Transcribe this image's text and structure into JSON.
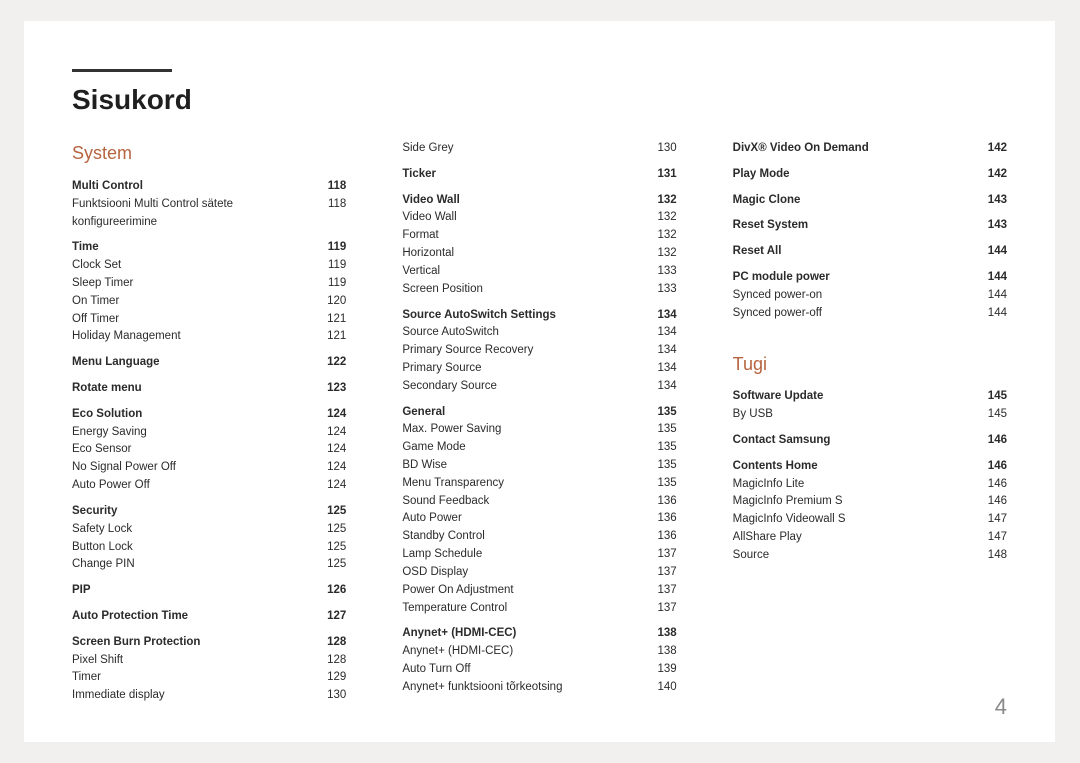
{
  "title": "Sisukord",
  "page_number": "4",
  "columns": [
    {
      "blocks": [
        {
          "type": "section",
          "label": "System"
        },
        {
          "type": "row",
          "bold": true,
          "label": "Multi Control",
          "page": "118"
        },
        {
          "type": "row",
          "label": "Funktsiooni Multi Control sätete konfigureerimine",
          "page": "118"
        },
        {
          "type": "gap"
        },
        {
          "type": "row",
          "bold": true,
          "label": "Time",
          "page": "119"
        },
        {
          "type": "row",
          "label": "Clock Set",
          "page": "119"
        },
        {
          "type": "row",
          "label": "Sleep Timer",
          "page": "119"
        },
        {
          "type": "row",
          "label": "On Timer",
          "page": "120"
        },
        {
          "type": "row",
          "label": "Off Timer",
          "page": "121"
        },
        {
          "type": "row",
          "label": "Holiday Management",
          "page": "121"
        },
        {
          "type": "gap"
        },
        {
          "type": "row",
          "bold": true,
          "label": "Menu Language",
          "page": "122"
        },
        {
          "type": "gap"
        },
        {
          "type": "row",
          "bold": true,
          "label": "Rotate menu",
          "page": "123"
        },
        {
          "type": "gap"
        },
        {
          "type": "row",
          "bold": true,
          "label": "Eco Solution",
          "page": "124"
        },
        {
          "type": "row",
          "label": "Energy Saving",
          "page": "124"
        },
        {
          "type": "row",
          "label": "Eco Sensor",
          "page": "124"
        },
        {
          "type": "row",
          "label": "No Signal Power Off",
          "page": "124"
        },
        {
          "type": "row",
          "label": "Auto Power Off",
          "page": "124"
        },
        {
          "type": "gap"
        },
        {
          "type": "row",
          "bold": true,
          "label": "Security",
          "page": "125"
        },
        {
          "type": "row",
          "label": "Safety Lock",
          "page": "125"
        },
        {
          "type": "row",
          "label": "Button Lock",
          "page": "125"
        },
        {
          "type": "row",
          "label": "Change PIN",
          "page": "125"
        },
        {
          "type": "gap"
        },
        {
          "type": "row",
          "bold": true,
          "label": "PIP",
          "page": "126"
        },
        {
          "type": "gap"
        },
        {
          "type": "row",
          "bold": true,
          "label": "Auto Protection Time",
          "page": "127"
        },
        {
          "type": "gap"
        },
        {
          "type": "row",
          "bold": true,
          "label": "Screen Burn Protection",
          "page": "128"
        },
        {
          "type": "row",
          "label": "Pixel Shift",
          "page": "128"
        },
        {
          "type": "row",
          "label": "Timer",
          "page": "129"
        },
        {
          "type": "row",
          "label": "Immediate display",
          "page": "130"
        }
      ]
    },
    {
      "blocks": [
        {
          "type": "row",
          "label": "Side Grey",
          "page": "130"
        },
        {
          "type": "gap"
        },
        {
          "type": "row",
          "bold": true,
          "label": "Ticker",
          "page": "131"
        },
        {
          "type": "gap"
        },
        {
          "type": "row",
          "bold": true,
          "label": "Video Wall",
          "page": "132"
        },
        {
          "type": "row",
          "label": "Video Wall",
          "page": "132"
        },
        {
          "type": "row",
          "label": "Format",
          "page": "132"
        },
        {
          "type": "row",
          "label": "Horizontal",
          "page": "132"
        },
        {
          "type": "row",
          "label": "Vertical",
          "page": "133"
        },
        {
          "type": "row",
          "label": "Screen Position",
          "page": "133"
        },
        {
          "type": "gap"
        },
        {
          "type": "row",
          "bold": true,
          "label": "Source AutoSwitch Settings",
          "page": "134"
        },
        {
          "type": "row",
          "label": "Source AutoSwitch",
          "page": "134"
        },
        {
          "type": "row",
          "label": "Primary Source Recovery",
          "page": "134"
        },
        {
          "type": "row",
          "label": "Primary Source",
          "page": "134"
        },
        {
          "type": "row",
          "label": "Secondary Source",
          "page": "134"
        },
        {
          "type": "gap"
        },
        {
          "type": "row",
          "bold": true,
          "label": "General",
          "page": "135"
        },
        {
          "type": "row",
          "label": "Max. Power Saving",
          "page": "135"
        },
        {
          "type": "row",
          "label": "Game Mode",
          "page": "135"
        },
        {
          "type": "row",
          "label": "BD Wise",
          "page": "135"
        },
        {
          "type": "row",
          "label": "Menu Transparency",
          "page": "135"
        },
        {
          "type": "row",
          "label": "Sound Feedback",
          "page": "136"
        },
        {
          "type": "row",
          "label": "Auto Power",
          "page": "136"
        },
        {
          "type": "row",
          "label": "Standby Control",
          "page": "136"
        },
        {
          "type": "row",
          "label": "Lamp Schedule",
          "page": "137"
        },
        {
          "type": "row",
          "label": "OSD Display",
          "page": "137"
        },
        {
          "type": "row",
          "label": "Power On Adjustment",
          "page": "137"
        },
        {
          "type": "row",
          "label": "Temperature Control",
          "page": "137"
        },
        {
          "type": "gap"
        },
        {
          "type": "row",
          "bold": true,
          "label": "Anynet+ (HDMI-CEC)",
          "page": "138"
        },
        {
          "type": "row",
          "label": "Anynet+ (HDMI-CEC)",
          "page": "138"
        },
        {
          "type": "row",
          "label": "Auto Turn Off",
          "page": "139"
        },
        {
          "type": "row",
          "label": "Anynet+ funktsiooni tõrkeotsing",
          "page": "140"
        }
      ]
    },
    {
      "blocks": [
        {
          "type": "row",
          "bold": true,
          "label": "DivX® Video On Demand",
          "page": "142"
        },
        {
          "type": "gap"
        },
        {
          "type": "row",
          "bold": true,
          "label": "Play Mode",
          "page": "142"
        },
        {
          "type": "gap"
        },
        {
          "type": "row",
          "bold": true,
          "label": "Magic Clone",
          "page": "143"
        },
        {
          "type": "gap"
        },
        {
          "type": "row",
          "bold": true,
          "label": "Reset System",
          "page": "143"
        },
        {
          "type": "gap"
        },
        {
          "type": "row",
          "bold": true,
          "label": "Reset All",
          "page": "144"
        },
        {
          "type": "gap"
        },
        {
          "type": "row",
          "bold": true,
          "label": "PC module power",
          "page": "144"
        },
        {
          "type": "row",
          "label": "Synced power-on",
          "page": "144"
        },
        {
          "type": "row",
          "label": "Synced power-off",
          "page": "144"
        },
        {
          "type": "section",
          "mtop": true,
          "label": "Tugi"
        },
        {
          "type": "row",
          "bold": true,
          "label": "Software Update",
          "page": "145"
        },
        {
          "type": "row",
          "label": "By USB",
          "page": "145"
        },
        {
          "type": "gap"
        },
        {
          "type": "row",
          "bold": true,
          "label": "Contact Samsung",
          "page": "146"
        },
        {
          "type": "gap"
        },
        {
          "type": "row",
          "bold": true,
          "label": "Contents Home",
          "page": "146"
        },
        {
          "type": "row",
          "label": "MagicInfo Lite",
          "page": "146"
        },
        {
          "type": "row",
          "label": "MagicInfo Premium S",
          "page": "146"
        },
        {
          "type": "row",
          "label": "MagicInfo Videowall S",
          "page": "147"
        },
        {
          "type": "row",
          "label": "AllShare Play",
          "page": "147"
        },
        {
          "type": "row",
          "label": "Source",
          "page": "148"
        }
      ]
    }
  ]
}
